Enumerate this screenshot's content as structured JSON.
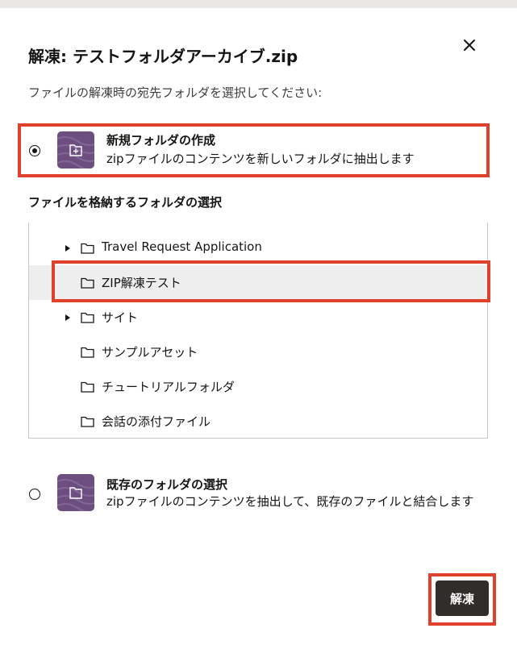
{
  "dialog": {
    "title": "解凍: テストフォルダアーカイブ.zip",
    "subtitle": "ファイルの解凍時の宛先フォルダを選択してください:",
    "close_icon": "close-icon"
  },
  "options": {
    "new_folder": {
      "title": "新規フォルダの作成",
      "description": "zipファイルのコンテンツを新しいフォルダに抽出します",
      "selected": true,
      "icon": "new-folder-icon"
    },
    "existing_folder": {
      "title": "既存のフォルダの選択",
      "description": "zipファイルのコンテンツを抽出して、既存のファイルと結合します",
      "selected": false,
      "icon": "folder-icon"
    }
  },
  "folder_section": {
    "label": "ファイルを格納するフォルダの選択",
    "items": [
      {
        "label": "Travel Request Application",
        "expandable": true,
        "selected": false
      },
      {
        "label": "ZIP解凍テスト",
        "expandable": false,
        "selected": true
      },
      {
        "label": "サイト",
        "expandable": true,
        "selected": false
      },
      {
        "label": "サンプルアセット",
        "expandable": false,
        "selected": false
      },
      {
        "label": "チュートリアルフォルダ",
        "expandable": false,
        "selected": false
      },
      {
        "label": "会話の添付ファイル",
        "expandable": false,
        "selected": false
      }
    ]
  },
  "footer": {
    "extract_label": "解凍"
  },
  "colors": {
    "highlight": "#e0412d",
    "primary_button": "#312d2a",
    "icon_tile": "#6c4f7e",
    "selected_row": "#eeeeee"
  }
}
